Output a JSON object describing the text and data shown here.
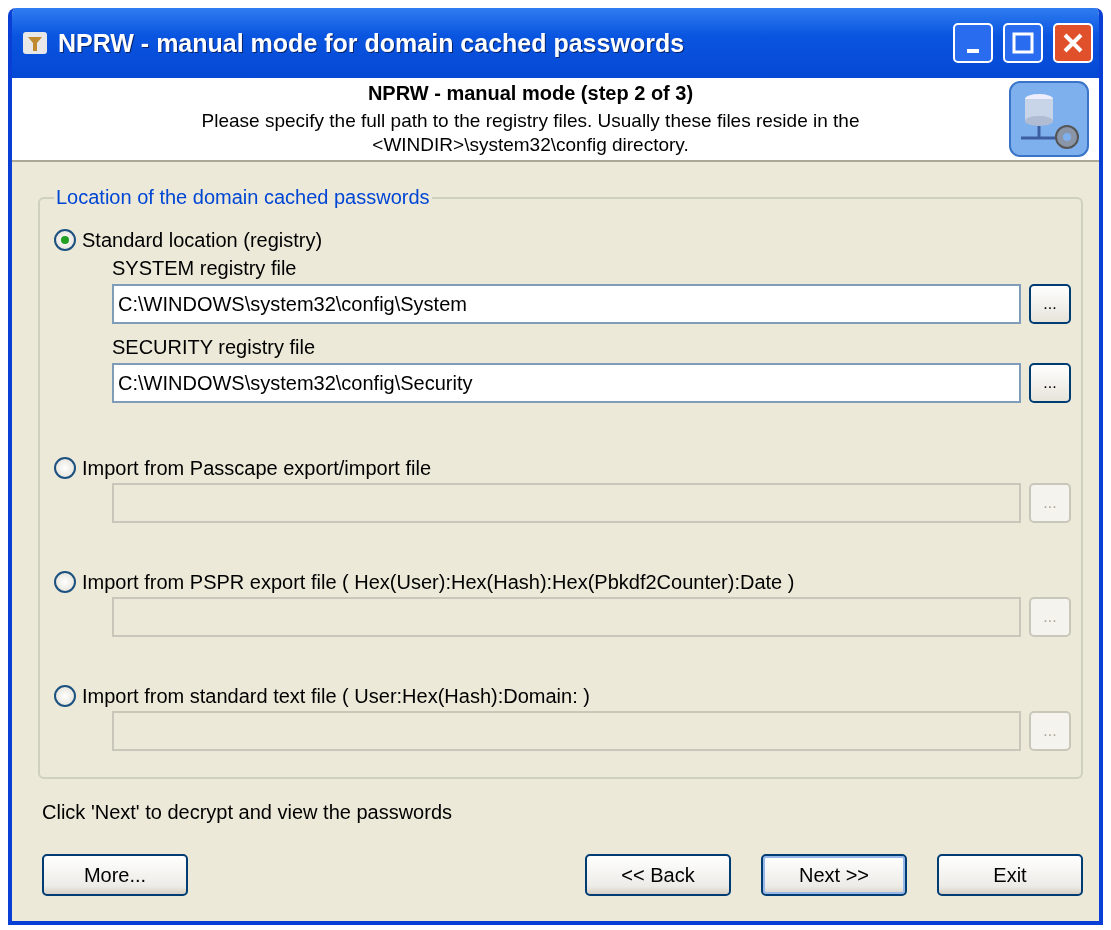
{
  "window": {
    "title": "NPRW - manual mode for domain cached passwords"
  },
  "header": {
    "title": "NPRW - manual mode (step 2 of 3)",
    "description": "Please specify the full path to the registry files. Usually these files reside in the <WINDIR>\\system32\\config directory."
  },
  "group": {
    "title": "Location of the domain cached passwords",
    "options": [
      {
        "label": "Standard location (registry)",
        "selected": true,
        "fields": [
          {
            "label": "SYSTEM registry file",
            "value": "C:\\WINDOWS\\system32\\config\\System",
            "button": "...",
            "disabled": false
          },
          {
            "label": "SECURITY registry file",
            "value": "C:\\WINDOWS\\system32\\config\\Security",
            "button": "...",
            "disabled": false
          }
        ]
      },
      {
        "label": "Import from Passcape export/import file",
        "selected": false,
        "fields": [
          {
            "button": "...",
            "disabled": true
          }
        ]
      },
      {
        "label": "Import from PSPR export file ( Hex(User):Hex(Hash):Hex(Pbkdf2Counter):Date )",
        "selected": false,
        "fields": [
          {
            "button": "...",
            "disabled": true
          }
        ]
      },
      {
        "label": "Import from standard text file ( User:Hex(Hash):Domain: )",
        "selected": false,
        "fields": [
          {
            "button": "...",
            "disabled": true
          }
        ]
      }
    ]
  },
  "hint": "Click 'Next' to decrypt and view the passwords",
  "buttons": [
    {
      "label": "More...",
      "kind": "left",
      "default": false
    },
    {
      "label": "<< Back",
      "kind": "right",
      "default": false
    },
    {
      "label": "Next >>",
      "kind": "right",
      "default": true
    },
    {
      "label": "Exit",
      "kind": "right",
      "default": false
    }
  ]
}
